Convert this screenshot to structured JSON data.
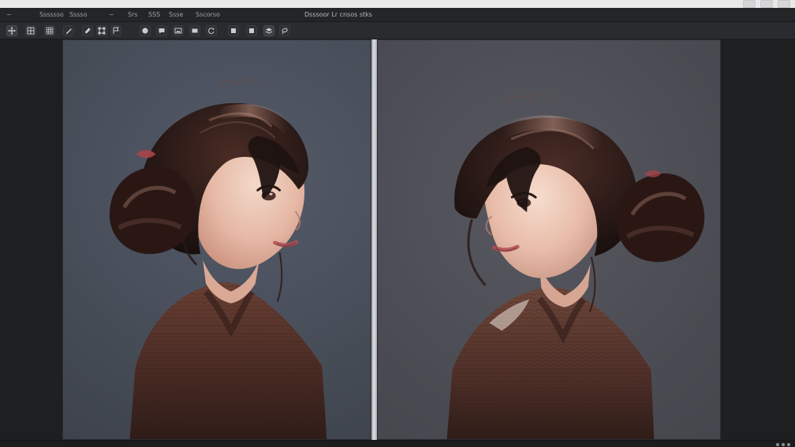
{
  "app": {
    "document_title": "Dsssoor Lr cnsos stks",
    "menu": [
      {
        "label": "~"
      },
      {
        "label": "Sssssso"
      },
      {
        "label": "Sssso"
      },
      {
        "label": "~"
      },
      {
        "label": "Srs"
      },
      {
        "label": "SSS"
      },
      {
        "label": "Ssse"
      },
      {
        "label": "Sscorso"
      }
    ]
  },
  "toolbar": {
    "tools": [
      {
        "name": "move-tool",
        "icon": "move-icon"
      },
      {
        "name": "brush-tool",
        "icon": "brush-icon"
      },
      {
        "name": "grid-tool",
        "icon": "grid-icon"
      },
      {
        "name": "grid-tool-2",
        "icon": "grid-icon"
      },
      {
        "name": "pen-tool",
        "icon": "pen-icon"
      },
      {
        "name": "transform-tool",
        "icon": "transform-icon"
      },
      {
        "name": "flag-tool",
        "icon": "flag-icon"
      },
      {
        "name": "circle-tool",
        "icon": "circle-icon"
      },
      {
        "name": "speech-tool",
        "icon": "speech-icon"
      },
      {
        "name": "image-tool",
        "icon": "image-icon"
      },
      {
        "name": "image-tool-2",
        "icon": "image-icon"
      },
      {
        "name": "rotate-tool",
        "icon": "rotate-icon"
      },
      {
        "name": "shape-tool",
        "icon": "shape-icon"
      },
      {
        "name": "shape-tool-2",
        "icon": "shape-icon"
      },
      {
        "name": "layers-tool",
        "icon": "layers-icon"
      },
      {
        "name": "lasso-tool",
        "icon": "lasso-icon"
      }
    ]
  },
  "colors": {
    "background": "#1f2022",
    "panel": "#2a2b2e",
    "divider": "#e9ecef"
  }
}
